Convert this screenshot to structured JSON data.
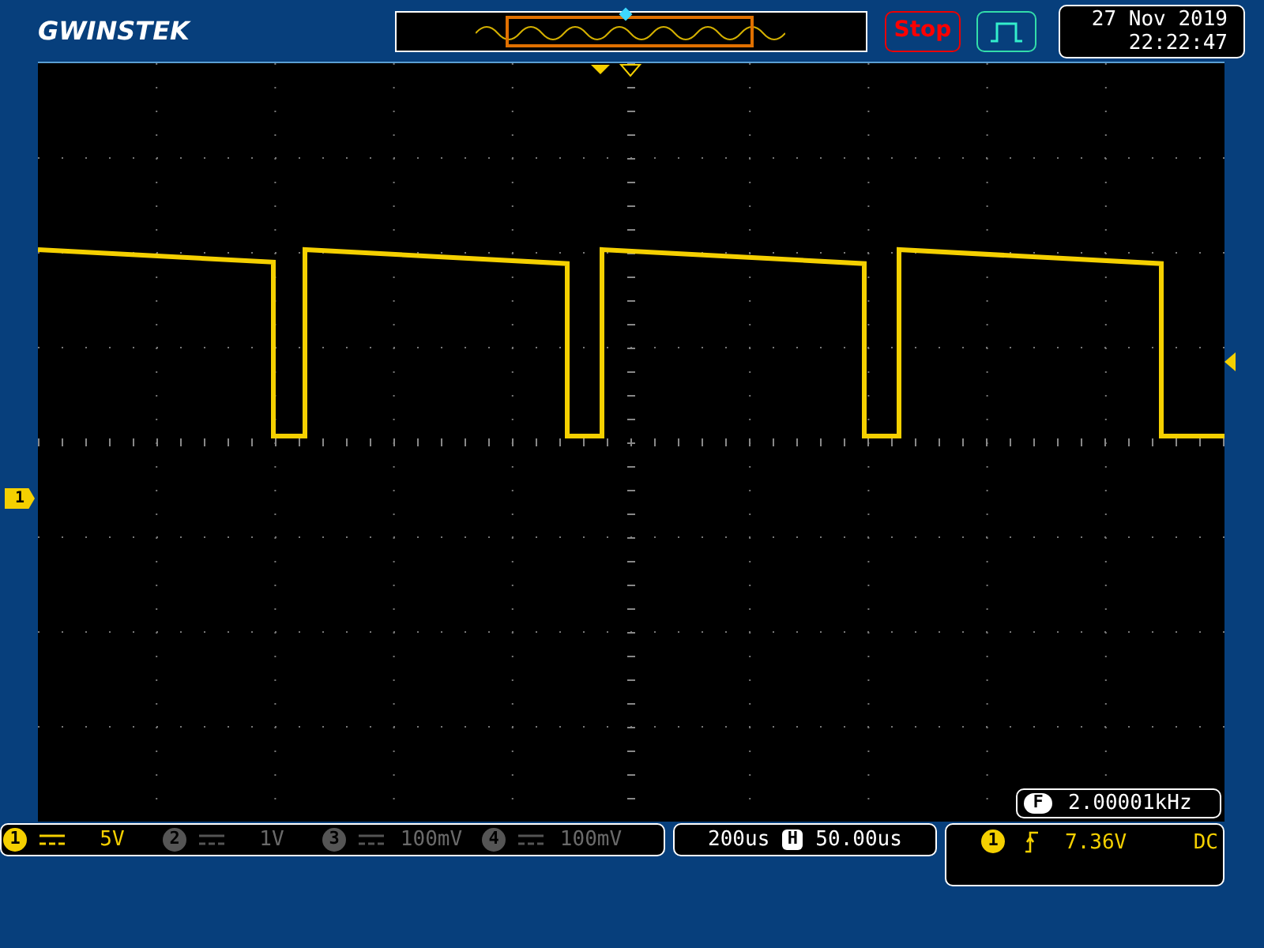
{
  "logo": "GWINSTEK",
  "run_state": {
    "label": "Stop",
    "running": false
  },
  "date": "27 Nov 2019",
  "time": "22:22:47",
  "channel_marker": "1",
  "frequency": {
    "label": "F",
    "value": "2.00001kHz"
  },
  "channels": [
    {
      "number": "1",
      "scale": "5V",
      "on": true
    },
    {
      "number": "2",
      "scale": "1V",
      "on": false
    },
    {
      "number": "3",
      "scale": "100mV",
      "on": false
    },
    {
      "number": "4",
      "scale": "100mV",
      "on": false
    }
  ],
  "timebase": {
    "scale": "200us",
    "position_label": "H",
    "position": "50.00us"
  },
  "trigger": {
    "source": "1",
    "rising_edge": true,
    "level": "7.36V",
    "coupling": "DC"
  }
}
